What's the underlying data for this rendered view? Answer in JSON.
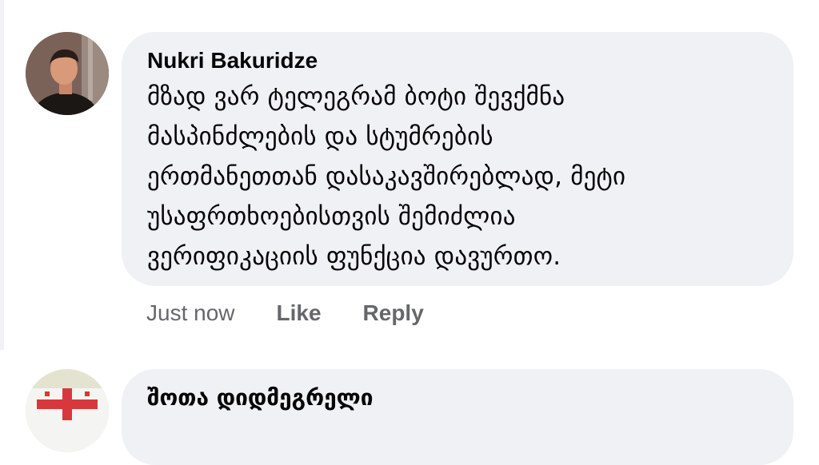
{
  "comment": {
    "author": "Nukri Bakuridze",
    "lines": [
      "მზად ვარ ტელეგრამ ბოტი შევქმნა",
      "მასპინძლების და სტუმრების",
      "ერთმანეთთან დასაკავშირებლად, მეტი",
      "უსაფრთხოებისთვის შემიძლია",
      "ვერიფიკაციის ფუნქცია დავურთო."
    ],
    "timestamp": "Just now",
    "like_label": "Like",
    "reply_label": "Reply"
  },
  "next_comment": {
    "author": "შოთა დიდმეგრელი"
  },
  "colors": {
    "bubble": "#f0f1f5",
    "action_text": "#65676b",
    "text": "#050505"
  }
}
